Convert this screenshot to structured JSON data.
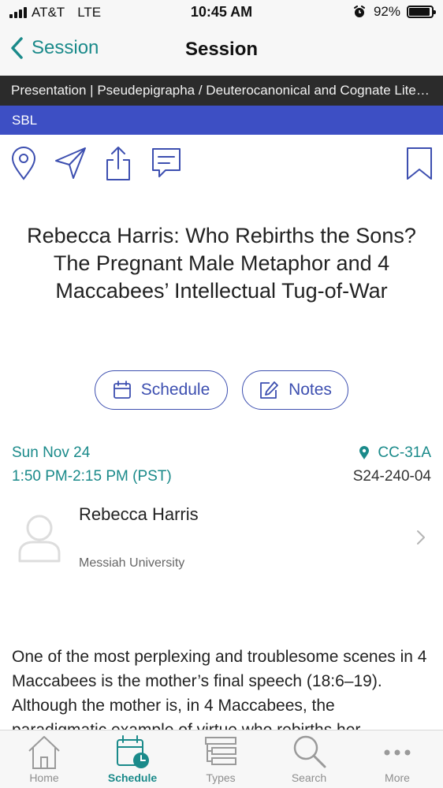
{
  "status_bar": {
    "carrier": "AT&T",
    "network": "LTE",
    "time": "10:45 AM",
    "battery_percent": "92%",
    "battery_level": 0.92
  },
  "nav": {
    "back_label": "Session",
    "title": "Session"
  },
  "session": {
    "track": "Presentation | Pseudepigrapha / Deuterocanonical and Cognate Literature",
    "organization": "SBL",
    "title": "Rebecca Harris: Who Rebirths the Sons? The Pregnant Male Metaphor and 4 Maccabees’ Intellectual Tug-of-War",
    "date": "Sun Nov 24",
    "time": "1:50 PM-2:15 PM (PST)",
    "room": "CC-31A",
    "code": "S24-240-04",
    "abstract": "One of the most perplexing and troublesome scenes in 4 Maccabees is the mother’s final speech (18:6–19). Although the mother is, in 4 Maccabees, the paradigmatic example of virtue who rebirths her"
  },
  "actions": {
    "schedule_label": "Schedule",
    "notes_label": "Notes"
  },
  "speaker": {
    "name": "Rebecca Harris",
    "affiliation": "Messiah University"
  },
  "tabs": [
    {
      "label": "Home",
      "icon": "home-icon"
    },
    {
      "label": "Schedule",
      "icon": "calendar-clock-icon",
      "active": true
    },
    {
      "label": "Types",
      "icon": "list-icon"
    },
    {
      "label": "Search",
      "icon": "search-icon"
    },
    {
      "label": "More",
      "icon": "ellipsis-icon"
    }
  ],
  "colors": {
    "accent_teal": "#1a8a8a",
    "pill_blue": "#3d4fb0",
    "org_bar": "#3d4fc4",
    "track_bar": "#2b2b2b"
  }
}
